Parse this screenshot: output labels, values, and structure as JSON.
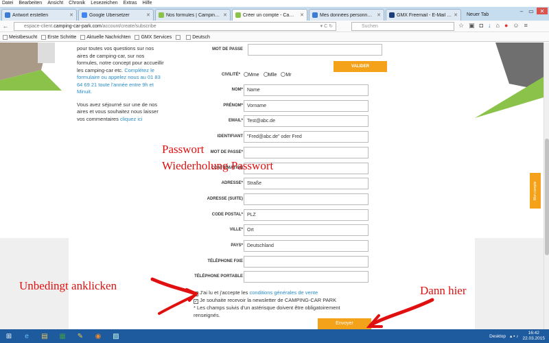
{
  "menu": [
    "Datei",
    "Bearbeiten",
    "Ansicht",
    "Chronik",
    "Lesezeichen",
    "Extras",
    "Hilfe"
  ],
  "tabs": [
    {
      "title": "Antwort erstellen",
      "color": "#3a7bd5",
      "active": false
    },
    {
      "title": "Google Übersetzer",
      "color": "#4285f4",
      "active": false
    },
    {
      "title": "Nos formules | Camping-C...",
      "color": "#8bc34a",
      "active": false
    },
    {
      "title": "Créer un compte - Campin...",
      "color": "#8bc34a",
      "active": true
    },
    {
      "title": "Mes données personnelles ...",
      "color": "#3a7bd5",
      "active": false
    },
    {
      "title": "GMX Freemail - E-Mail ma...",
      "color": "#1c3f7a",
      "active": false
    }
  ],
  "new_tab_label": "Neuer Tab",
  "url": {
    "prefix": "espace-client.",
    "domain": "camping-car-park.com",
    "path": "/account/create/subscribe"
  },
  "search_placeholder": "Suchen",
  "bookmarks": [
    "Meistbesucht",
    "Erste Schritte",
    "Aktuelle Nachrichten",
    "GMX Services",
    "",
    "Deutsch"
  ],
  "left_text": {
    "p1": "pour toutes vos questions sur nos aires de camping-car, sur nos formules, notre concept pour accueillir les camping-car etc.",
    "p1_link": "Complétez le formulaire ou appelez nous au 01 83 64 69 21 toute l'année entre 9h et Minuit.",
    "p2": "Vous avez séjourné sur une de nos aires et vous souhaitez nous laisser vos commentaires ",
    "p2_link": "cliquez ici"
  },
  "form": {
    "mot_de_passe_top": "MOT DE PASSE",
    "valider": "VALIDER",
    "civilite_label": "CIVILITÉ*",
    "civilite_options": [
      "Mme",
      "Mlle",
      "Mr"
    ],
    "fields": [
      {
        "label": "NOM*",
        "value": "Name"
      },
      {
        "label": "PRÉNOM*",
        "value": "Vorname"
      },
      {
        "label": "EMAIL*",
        "value": "Test@abc.de"
      },
      {
        "label": "IDENTIFIANT",
        "value": "\"Fred@abc.de\"  oder Fred"
      },
      {
        "label": "MOT DE PASSE*",
        "value": ""
      },
      {
        "label": "CONFIRMATION",
        "value": ""
      },
      {
        "label": "ADRESSE*",
        "value": "Straße"
      },
      {
        "label": "ADRESSE (SUITE)",
        "value": ""
      },
      {
        "label": "CODE POSTAL*",
        "value": "PLZ"
      },
      {
        "label": "VILLE*",
        "value": "Ort"
      },
      {
        "label": "PAYS*",
        "value": "Deutschland"
      },
      {
        "label": "TÉLÉPHONE FIXE",
        "value": ""
      },
      {
        "label": "TÉLÉPHONE PORTABLE",
        "value": ""
      }
    ],
    "cgv_prefix": "J'ai lu et j'accepte les ",
    "cgv_link": "conditions générales de vente",
    "newsletter": "Je souhaite recevoir la newsletter de CAMPING-CAR PARK",
    "required_note": "* Les champs suivis d'un astérisque doivent être obligatoirement renseignés.",
    "envoyer": "Envoyer"
  },
  "mon_compte": "Mon compte",
  "annotations": {
    "passwort": "Passwort",
    "wiederholung": "Wiederholung Passwort",
    "unbedingt": "Unbedingt anklicken",
    "dann_hier": "Dann hier"
  },
  "taskbar": {
    "desktop_label": "Desktop",
    "time": "16:42",
    "date": "22.03.2015"
  },
  "colors": {
    "accent_orange": "#f5a21b",
    "link_blue": "#2a8cc8",
    "annotation_red": "#e01010",
    "brand_green": "#8bc34a"
  }
}
